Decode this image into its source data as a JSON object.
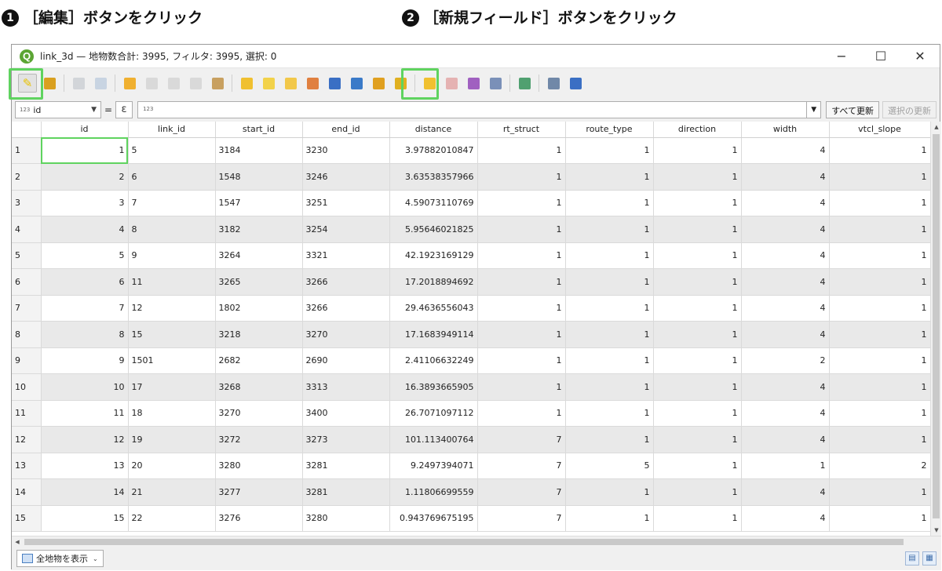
{
  "captions": [
    {
      "num": "1",
      "text": "［編集］ボタンをクリック"
    },
    {
      "num": "2",
      "text": "［新規フィールド］ボタンをクリック"
    }
  ],
  "window": {
    "title": "link_3d — 地物数合計: 3995, フィルタ: 3995, 選択: 0",
    "logo": "Q",
    "controls": {
      "minimize": "−",
      "maximize": "☐",
      "close": "✕"
    }
  },
  "toolbar": {
    "icons": [
      {
        "name": "toggle-editing-icon",
        "color": "#e8c200",
        "glyph": "✎"
      },
      {
        "name": "multi-edit-icon",
        "color": "#d9a020"
      },
      {
        "name": "save-edits-icon",
        "color": "#9aa4b0",
        "dim": true
      },
      {
        "name": "reload-icon",
        "color": "#7ea0c8",
        "dim": true
      },
      {
        "name": "add-feature-icon",
        "color": "#f0b030"
      },
      {
        "name": "delete-selected-icon",
        "color": "#b0b0b0",
        "dim": true
      },
      {
        "name": "cut-icon",
        "color": "#b0b0b0",
        "dim": true
      },
      {
        "name": "copy-icon",
        "color": "#b0b0b0",
        "dim": true
      },
      {
        "name": "paste-icon",
        "color": "#c8a060"
      },
      {
        "name": "select-by-expression-icon",
        "color": "#f0c030"
      },
      {
        "name": "select-all-icon",
        "color": "#f2d24a"
      },
      {
        "name": "invert-selection-icon",
        "color": "#f2c84a"
      },
      {
        "name": "deselect-all-icon",
        "color": "#e08040"
      },
      {
        "name": "filter-icon",
        "color": "#3a6fc4"
      },
      {
        "name": "move-selection-top-icon",
        "color": "#3a7ac8"
      },
      {
        "name": "pan-to-selected-icon",
        "color": "#e0a020"
      },
      {
        "name": "zoom-to-selected-icon",
        "color": "#e0b020"
      },
      {
        "name": "new-field-icon",
        "color": "#f0c030"
      },
      {
        "name": "delete-field-icon",
        "color": "#d04040",
        "dim": true
      },
      {
        "name": "field-calculator-icon",
        "color": "#a060c0"
      },
      {
        "name": "conditional-formatting-icon",
        "color": "#7a90b8"
      },
      {
        "name": "dock-attribute-table-icon",
        "color": "#50a070"
      },
      {
        "name": "actions-icon",
        "color": "#7088a8"
      },
      {
        "name": "zoom-map-icon",
        "color": "#3a6fc4"
      }
    ]
  },
  "expression_bar": {
    "field_type_tag": "123",
    "field": "id",
    "operator": "=",
    "epsilon": "ε",
    "input_tag": "123",
    "update_all": "すべて更新",
    "update_selected": "選択の更新"
  },
  "table": {
    "columns": [
      "id",
      "link_id",
      "start_id",
      "end_id",
      "distance",
      "rt_struct",
      "route_type",
      "direction",
      "width",
      "vtcl_slope"
    ],
    "rows": [
      [
        "1",
        "1",
        "5",
        "3184",
        "3230",
        "3.97882010847",
        "1",
        "1",
        "1",
        "4",
        "1"
      ],
      [
        "2",
        "2",
        "6",
        "1548",
        "3246",
        "3.63538357966",
        "1",
        "1",
        "1",
        "4",
        "1"
      ],
      [
        "3",
        "3",
        "7",
        "1547",
        "3251",
        "4.59073110769",
        "1",
        "1",
        "1",
        "4",
        "1"
      ],
      [
        "4",
        "4",
        "8",
        "3182",
        "3254",
        "5.95646021825",
        "1",
        "1",
        "1",
        "4",
        "1"
      ],
      [
        "5",
        "5",
        "9",
        "3264",
        "3321",
        "42.1923169129",
        "1",
        "1",
        "1",
        "4",
        "1"
      ],
      [
        "6",
        "6",
        "11",
        "3265",
        "3266",
        "17.2018894692",
        "1",
        "1",
        "1",
        "4",
        "1"
      ],
      [
        "7",
        "7",
        "12",
        "1802",
        "3266",
        "29.4636556043",
        "1",
        "1",
        "1",
        "4",
        "1"
      ],
      [
        "8",
        "8",
        "15",
        "3218",
        "3270",
        "17.1683949114",
        "1",
        "1",
        "1",
        "4",
        "1"
      ],
      [
        "9",
        "9",
        "1501",
        "2682",
        "2690",
        "2.41106632249",
        "1",
        "1",
        "1",
        "2",
        "1"
      ],
      [
        "10",
        "10",
        "17",
        "3268",
        "3313",
        "16.3893665905",
        "1",
        "1",
        "1",
        "4",
        "1"
      ],
      [
        "11",
        "11",
        "18",
        "3270",
        "3400",
        "26.7071097112",
        "1",
        "1",
        "1",
        "4",
        "1"
      ],
      [
        "12",
        "12",
        "19",
        "3272",
        "3273",
        "101.113400764",
        "7",
        "1",
        "1",
        "4",
        "1"
      ],
      [
        "13",
        "13",
        "20",
        "3280",
        "3281",
        "9.2497394071",
        "7",
        "5",
        "1",
        "1",
        "2"
      ],
      [
        "14",
        "14",
        "21",
        "3277",
        "3281",
        "1.11806699559",
        "7",
        "1",
        "1",
        "4",
        "1"
      ],
      [
        "15",
        "15",
        "22",
        "3276",
        "3280",
        "0.943769675195",
        "7",
        "1",
        "1",
        "4",
        "1"
      ]
    ]
  },
  "scroll": {
    "up": "▲",
    "down": "▼",
    "left": "◀"
  },
  "status": {
    "show_features": "全地物を表示",
    "dropdown": "⌄",
    "form_view": "▤",
    "table_view": "▦"
  }
}
